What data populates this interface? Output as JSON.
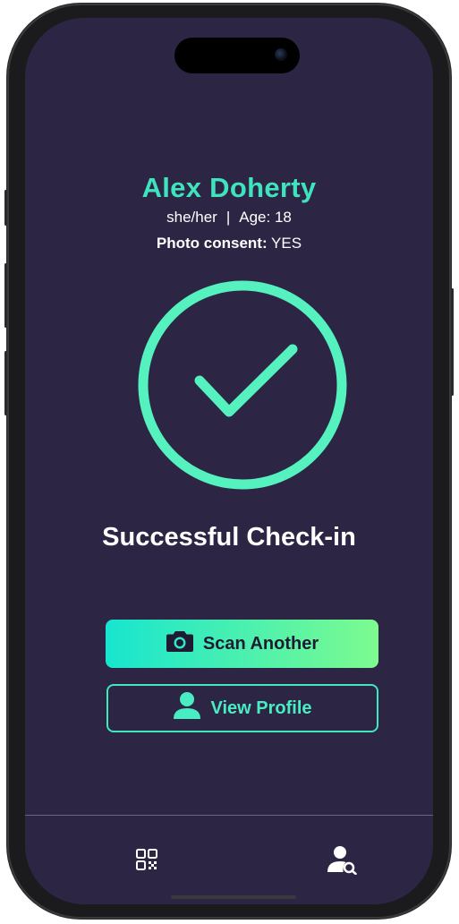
{
  "attendee": {
    "name": "Alex Doherty",
    "pronouns": "she/her",
    "separator": "|",
    "age_label": "Age: 18",
    "consent_label": "Photo consent:",
    "consent_value": "YES"
  },
  "status": {
    "message": "Successful Check-in",
    "icon": "check-circle-icon"
  },
  "actions": {
    "scan_another_label": "Scan Another",
    "scan_another_icon": "camera-icon",
    "view_profile_label": "View Profile",
    "view_profile_icon": "person-icon"
  },
  "tabbar": {
    "items": [
      {
        "icon": "qr-code-icon"
      },
      {
        "icon": "person-search-icon"
      }
    ]
  },
  "colors": {
    "background": "#2c2644",
    "accent": "#3fe3be",
    "gradient_start": "#17e5cf",
    "gradient_end": "#7dfb8f"
  }
}
